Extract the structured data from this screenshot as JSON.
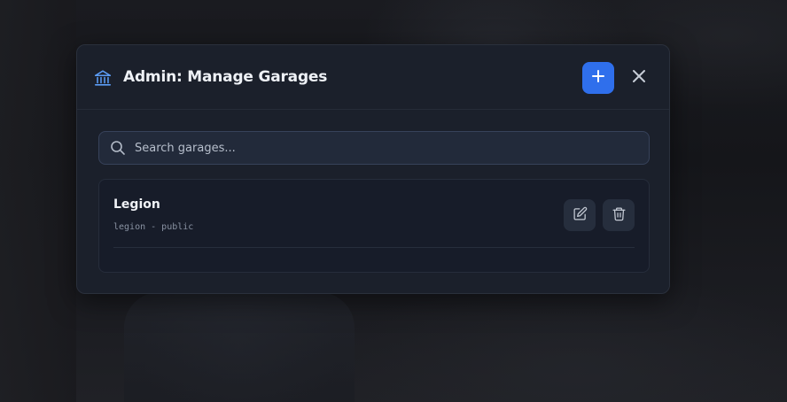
{
  "modal": {
    "title": "Admin: Manage Garages",
    "header_icon": "bank-icon",
    "add_button_icon": "plus-icon",
    "close_button_icon": "close-icon",
    "accent_color": "#2f6fec"
  },
  "search": {
    "placeholder": "Search garages...",
    "value": ""
  },
  "garages": [
    {
      "name": "Legion",
      "meta": "legion - public",
      "edit_icon": "pencil-icon",
      "delete_icon": "trash-icon"
    }
  ]
}
